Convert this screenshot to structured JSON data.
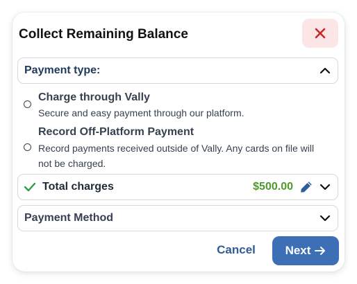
{
  "modal": {
    "title": "Collect Remaining Balance"
  },
  "payment_type": {
    "label": "Payment type:",
    "options": [
      {
        "title": "Charge through Vally",
        "description": "Secure and easy payment through our platform.",
        "selected": false
      },
      {
        "title": "Record Off-Platform Payment",
        "description": "Record payments received outside of Vally. Any cards on file will not be charged.",
        "selected": false
      }
    ]
  },
  "total_charges": {
    "label": "Total charges",
    "amount": "$500.00"
  },
  "payment_method": {
    "label": "Payment Method"
  },
  "footer": {
    "cancel_label": "Cancel",
    "next_label": "Next"
  },
  "icons": {
    "close": "close-icon",
    "chevron_up": "chevron-up-icon",
    "chevron_down": "chevron-down-icon",
    "check": "check-icon",
    "pencil": "pencil-icon",
    "arrow_right": "arrow-right-icon"
  },
  "colors": {
    "navy_label": "#1e3a5f",
    "close_bg": "#fbe5e6",
    "close_x": "#c62828",
    "amount_green": "#4d9a2b",
    "check_green": "#2e9d48",
    "pencil_blue": "#2e5d9a",
    "cancel_blue": "#2e5d9a",
    "next_bg": "#3d6fb6"
  }
}
